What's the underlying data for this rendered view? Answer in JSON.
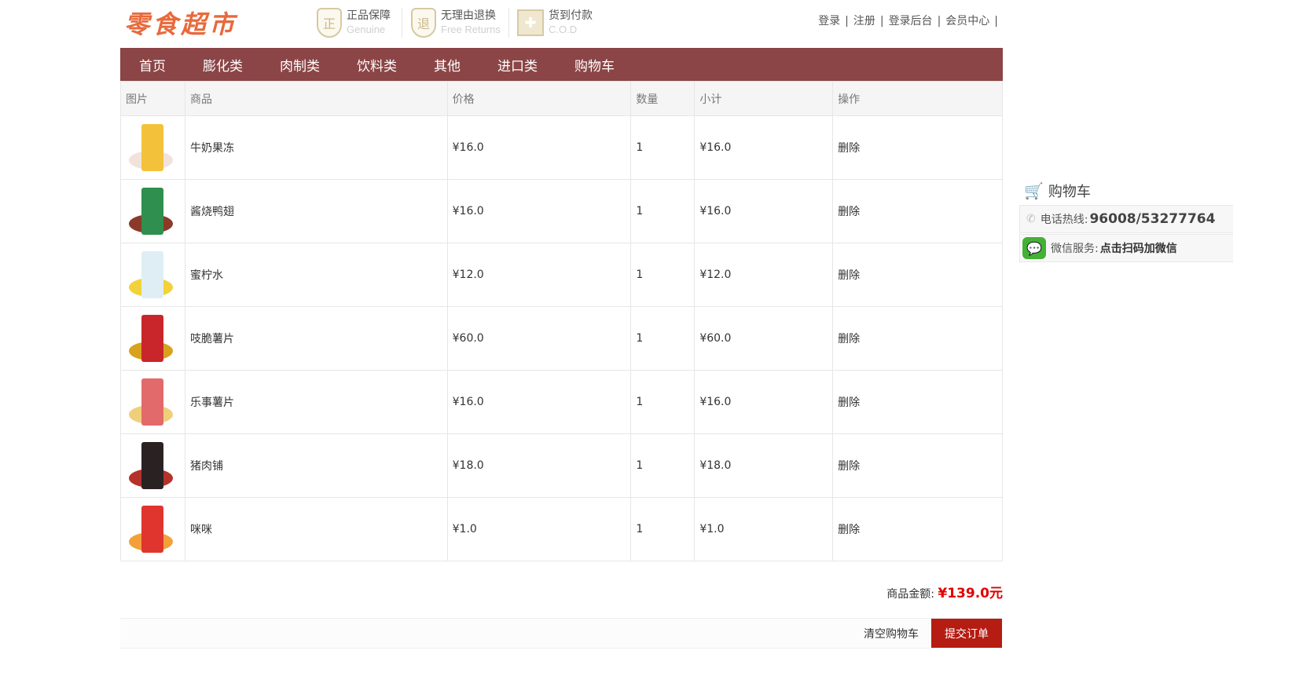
{
  "header": {
    "logo": "零食超市",
    "badges": [
      {
        "icon": "shield-icon",
        "glyph": "正",
        "title": "正品保障",
        "subtitle": "Genuine"
      },
      {
        "icon": "shield-icon",
        "glyph": "退",
        "title": "无理由退换",
        "subtitle": "Free Returns"
      },
      {
        "icon": "gift-icon",
        "glyph": "✚",
        "title": "货到付款",
        "subtitle": "C.O.D"
      }
    ],
    "links": [
      "登录",
      "注册",
      "登录后台",
      "会员中心"
    ],
    "separator": "|"
  },
  "nav": [
    "首页",
    "膨化类",
    "肉制类",
    "饮料类",
    "其他",
    "进口类",
    "购物车"
  ],
  "table": {
    "headers": [
      "图片",
      "商品",
      "价格",
      "数量",
      "小计",
      "操作"
    ],
    "rows": [
      {
        "name": "牛奶果冻",
        "price": "¥16.0",
        "qty": "1",
        "subtotal": "¥16.0",
        "action": "删除",
        "c1": "#f3c23a",
        "c2": "#f1e3dc"
      },
      {
        "name": "酱烧鸭翅",
        "price": "¥16.0",
        "qty": "1",
        "subtotal": "¥16.0",
        "action": "删除",
        "c1": "#2f8f4e",
        "c2": "#8b3a2a"
      },
      {
        "name": "蜜柠水",
        "price": "¥12.0",
        "qty": "1",
        "subtotal": "¥12.0",
        "action": "删除",
        "c1": "#dfeef5",
        "c2": "#f2d23a"
      },
      {
        "name": "吱脆薯片",
        "price": "¥60.0",
        "qty": "1",
        "subtotal": "¥60.0",
        "action": "删除",
        "c1": "#c8262a",
        "c2": "#d8a21e"
      },
      {
        "name": "乐事薯片",
        "price": "¥16.0",
        "qty": "1",
        "subtotal": "¥16.0",
        "action": "删除",
        "c1": "#e36a6a",
        "c2": "#f0cf7a"
      },
      {
        "name": "猪肉铺",
        "price": "¥18.0",
        "qty": "1",
        "subtotal": "¥18.0",
        "action": "删除",
        "c1": "#2a2222",
        "c2": "#b5322a"
      },
      {
        "name": "咪咪",
        "price": "¥1.0",
        "qty": "1",
        "subtotal": "¥1.0",
        "action": "删除",
        "c1": "#e0352e",
        "c2": "#f2a13a"
      }
    ]
  },
  "summary": {
    "label": "商品金额:",
    "amount": "¥139.0元"
  },
  "actions": {
    "clear": "清空购物车",
    "submit": "提交订单"
  },
  "sidebar": {
    "cart_label": "购物车",
    "phone_label": "电话热线:",
    "phone_number": "96008/53277764",
    "wechat_label": "微信服务:",
    "wechat_text": "点击扫码加微信"
  },
  "colors": {
    "nav_bg": "#8b4546",
    "accent_red": "#e00000",
    "submit_bg": "#b51c12",
    "logo": "#e86a3c"
  }
}
